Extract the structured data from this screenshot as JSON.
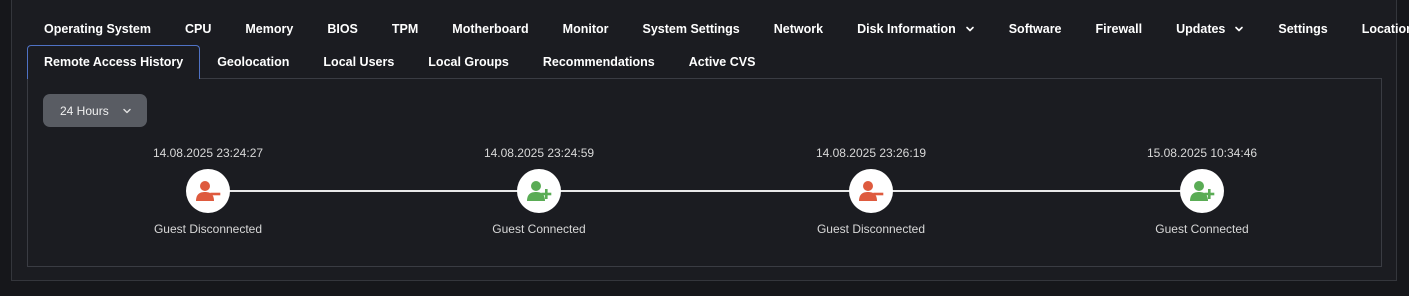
{
  "tabs_row1": [
    {
      "label": "Operating System",
      "has_dropdown": false
    },
    {
      "label": "CPU",
      "has_dropdown": false
    },
    {
      "label": "Memory",
      "has_dropdown": false
    },
    {
      "label": "BIOS",
      "has_dropdown": false
    },
    {
      "label": "TPM",
      "has_dropdown": false
    },
    {
      "label": "Motherboard",
      "has_dropdown": false
    },
    {
      "label": "Monitor",
      "has_dropdown": false
    },
    {
      "label": "System Settings",
      "has_dropdown": false
    },
    {
      "label": "Network",
      "has_dropdown": false
    },
    {
      "label": "Disk Information",
      "has_dropdown": true
    },
    {
      "label": "Software",
      "has_dropdown": false
    },
    {
      "label": "Firewall",
      "has_dropdown": false
    },
    {
      "label": "Updates",
      "has_dropdown": true
    },
    {
      "label": "Settings",
      "has_dropdown": false
    },
    {
      "label": "Location",
      "has_dropdown": false
    }
  ],
  "tabs_row2": [
    {
      "label": "Remote Access History",
      "active": true
    },
    {
      "label": "Geolocation",
      "active": false
    },
    {
      "label": "Local Users",
      "active": false
    },
    {
      "label": "Local Groups",
      "active": false
    },
    {
      "label": "Recommendations",
      "active": false
    },
    {
      "label": "Active CVS",
      "active": false
    }
  ],
  "filter": {
    "selected": "24 Hours",
    "icon": "chevron-down-icon"
  },
  "timeline": {
    "events": [
      {
        "timestamp": "14.08.2025 23:24:27",
        "label": "Guest Disconnected",
        "type": "disconnected",
        "icon": "user-remove-icon"
      },
      {
        "timestamp": "14.08.2025 23:24:59",
        "label": "Guest Connected",
        "type": "connected",
        "icon": "user-add-icon"
      },
      {
        "timestamp": "14.08.2025 23:26:19",
        "label": "Guest Disconnected",
        "type": "disconnected",
        "icon": "user-remove-icon"
      },
      {
        "timestamp": "15.08.2025 10:34:46",
        "label": "Guest Connected",
        "type": "connected",
        "icon": "user-add-icon"
      }
    ]
  },
  "colors": {
    "disconnected": "#de5a3e",
    "connected": "#5aac55",
    "active_tab_border": "#4f72c4"
  }
}
